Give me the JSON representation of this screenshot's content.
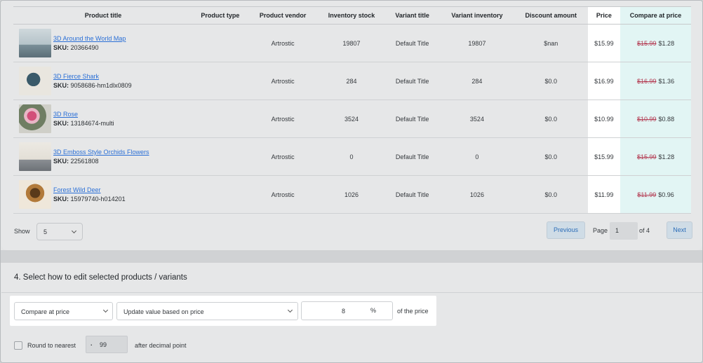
{
  "table": {
    "headers": [
      "Product title",
      "Product type",
      "Product vendor",
      "Inventory stock",
      "Variant title",
      "Variant inventory",
      "Discount amount",
      "Price",
      "Compare at price"
    ],
    "rows": [
      {
        "title": "3D Around the World Map",
        "sku_label": "SKU:",
        "sku": "20366490",
        "type": "",
        "vendor": "Artrostic",
        "stock": "19807",
        "variant": "Default Title",
        "variant_inventory": "19807",
        "discount": "$nan",
        "price": "$15.99",
        "compare_old": "$15.99",
        "compare_new": "$1.28",
        "thumb_icon": "world-map-thumbnail"
      },
      {
        "title": "3D Fierce Shark",
        "sku_label": "SKU:",
        "sku": "9058686-hm1dlx0809",
        "type": "",
        "vendor": "Artrostic",
        "stock": "284",
        "variant": "Default Title",
        "variant_inventory": "284",
        "discount": "$0.0",
        "price": "$16.99",
        "compare_old": "$16.99",
        "compare_new": "$1.36",
        "thumb_icon": "shark-thumbnail"
      },
      {
        "title": "3D Rose",
        "sku_label": "SKU:",
        "sku": "13184674-multi",
        "type": "",
        "vendor": "Artrostic",
        "stock": "3524",
        "variant": "Default Title",
        "variant_inventory": "3524",
        "discount": "$0.0",
        "price": "$10.99",
        "compare_old": "$10.99",
        "compare_new": "$0.88",
        "thumb_icon": "rose-thumbnail"
      },
      {
        "title": "3D Emboss Style Orchids Flowers",
        "sku_label": "SKU:",
        "sku": "22561808",
        "type": "",
        "vendor": "Artrostic",
        "stock": "0",
        "variant": "Default Title",
        "variant_inventory": "0",
        "discount": "$0.0",
        "price": "$15.99",
        "compare_old": "$15.99",
        "compare_new": "$1.28",
        "thumb_icon": "orchid-thumbnail"
      },
      {
        "title": "Forest Wild Deer",
        "sku_label": "SKU:",
        "sku": "15979740-h014201",
        "type": "",
        "vendor": "Artrostic",
        "stock": "1026",
        "variant": "Default Title",
        "variant_inventory": "1026",
        "discount": "$0.0",
        "price": "$11.99",
        "compare_old": "$11.99",
        "compare_new": "$0.96",
        "thumb_icon": "deer-thumbnail"
      }
    ]
  },
  "pager": {
    "show_label": "Show",
    "show_value": "5",
    "prev_label": "Previous",
    "page_label": "Page",
    "page_value": "1",
    "of_label": "of 4",
    "next_label": "Next"
  },
  "section4": {
    "title": "4. Select how to edit selected products / variants",
    "field_select": "Compare at price",
    "method_select": "Update value based on price",
    "amount_value": "8",
    "amount_unit": "%",
    "suffix": "of the price",
    "round_label": "Round to nearest",
    "round_prefix": ".",
    "round_value": "99",
    "after_label": "after decimal point"
  },
  "colors": {
    "link": "#2a6fd6",
    "strike": "#b43b52",
    "compare_bg": "#e2f5f4",
    "button_text": "#2c6db8"
  }
}
